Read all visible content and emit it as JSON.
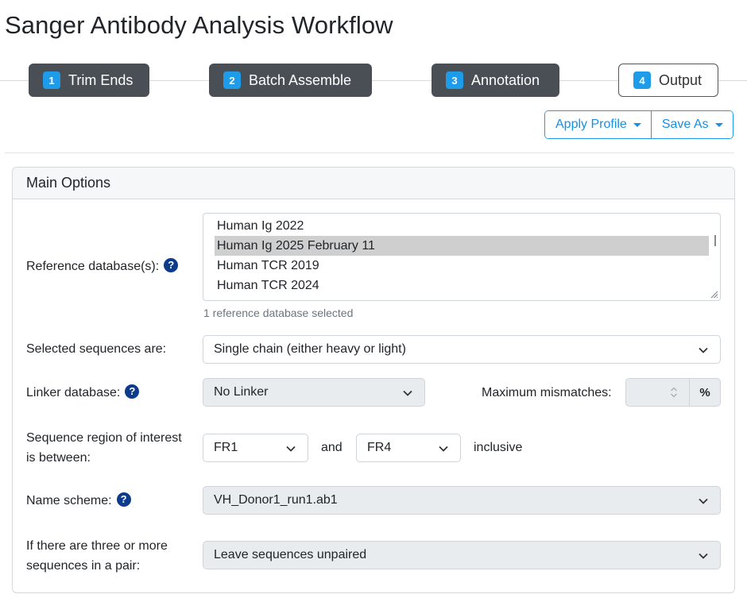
{
  "title": "Sanger Antibody Analysis Workflow",
  "steps": [
    {
      "num": "1",
      "label": "Trim Ends"
    },
    {
      "num": "2",
      "label": "Batch Assemble"
    },
    {
      "num": "3",
      "label": "Annotation"
    },
    {
      "num": "4",
      "label": "Output"
    }
  ],
  "toolbar": {
    "apply_profile": "Apply Profile",
    "save_as": "Save As"
  },
  "card": {
    "header": "Main Options"
  },
  "reference": {
    "label": "Reference database(s):",
    "options": [
      "Human Ig 2022",
      "Human Ig 2025 February 11",
      "Human TCR 2019",
      "Human TCR 2024"
    ],
    "selected": "Human Ig 2025 February 11",
    "hint": "1 reference database selected"
  },
  "selected_seq": {
    "label": "Selected sequences are:",
    "value": "Single chain (either heavy or light)"
  },
  "linker": {
    "label": "Linker database:",
    "value": "No Linker",
    "mismatch_label": "Maximum mismatches:",
    "mismatch_value": "",
    "unit": "%"
  },
  "region": {
    "label_line1": "Sequence region of interest",
    "label_line2": "is between:",
    "from": "FR1",
    "and": "and",
    "to": "FR4",
    "inclusive": "inclusive"
  },
  "name_scheme": {
    "label": "Name scheme:",
    "value": "VH_Donor1_run1.ab1"
  },
  "pairing": {
    "label_line1": "If there are three or more",
    "label_line2": "sequences in a pair:",
    "value": "Leave sequences unpaired"
  },
  "help_glyph": "?",
  "colors": {
    "accent": "#1e9be9",
    "step_bg": "#4a4f55",
    "help": "#0d3b8c"
  }
}
